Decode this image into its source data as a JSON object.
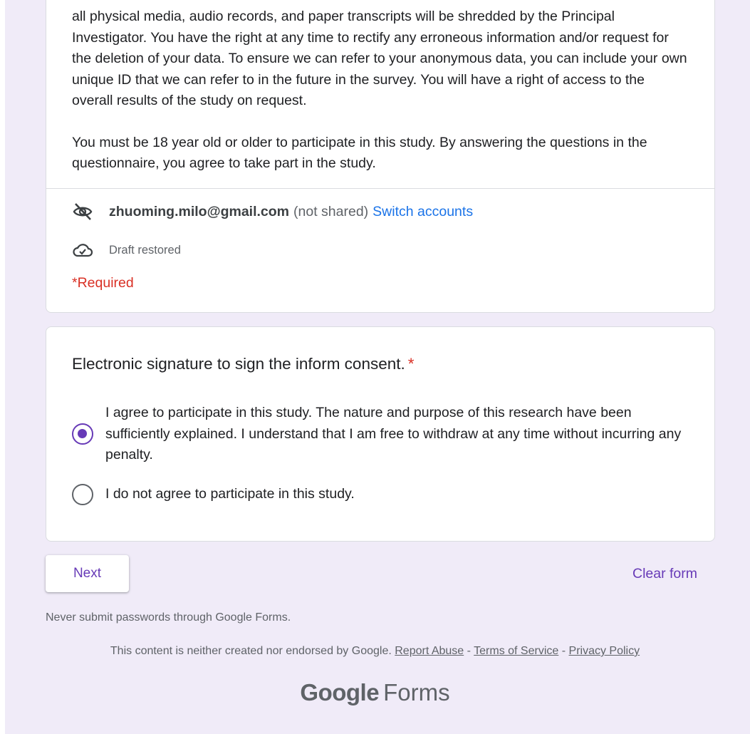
{
  "description": {
    "paragraph1": "all physical media, audio records, and paper transcripts will be shredded by the Principal Investigator. You have the right at any time to rectify any erroneous information and/or request for the deletion of your data. To ensure we can refer to your anonymous data, you can include your own unique ID that we can refer to in the future in the survey. You will have a right of access to the overall results of the study on request.",
    "paragraph2": "You must be 18 year old or older to participate in this study. By answering the questions in the questionnaire, you agree to take part in the study."
  },
  "account": {
    "email": "zhuoming.milo@gmail.com",
    "not_shared": "(not shared)",
    "switch_label": "Switch accounts",
    "icon": "eye-off-icon"
  },
  "draft": {
    "label": "Draft restored",
    "icon": "cloud-check-icon"
  },
  "required_note": "*Required",
  "question": {
    "title": "Electronic signature to sign the inform consent.",
    "required_mark": "*",
    "options": [
      {
        "label": "I agree to participate in this study. The nature and purpose of this research have been sufficiently explained. I understand that I am free to withdraw at any time without incurring any penalty.",
        "selected": true
      },
      {
        "label": "I do not agree to participate in this study.",
        "selected": false
      }
    ]
  },
  "actions": {
    "next_label": "Next",
    "clear_label": "Clear form"
  },
  "footer": {
    "warning": "Never submit passwords through Google Forms.",
    "disclaimer": "This content is neither created nor endorsed by Google.",
    "report_abuse": "Report Abuse",
    "terms": "Terms of Service",
    "privacy": "Privacy Policy",
    "sep": "-",
    "brand_google": "Google",
    "brand_forms": "Forms"
  },
  "colors": {
    "accent": "#673ab7",
    "background": "#f0ebf8",
    "required": "#d93025",
    "link": "#1a73e8"
  }
}
